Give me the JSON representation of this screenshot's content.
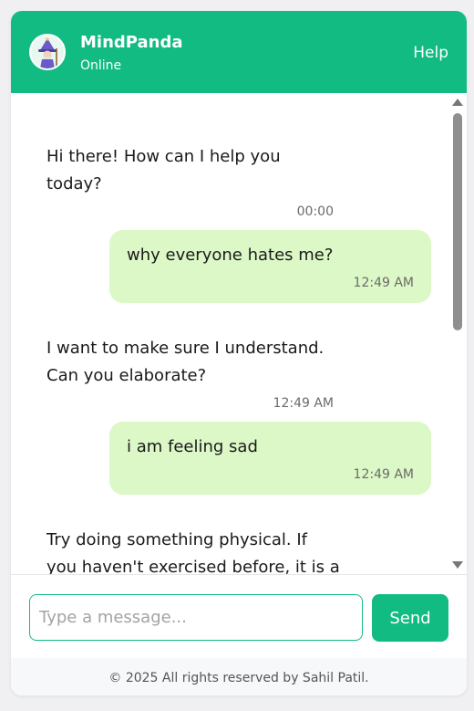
{
  "header": {
    "title": "MindPanda",
    "status": "Online",
    "help_label": "Help",
    "avatar_icon": "wizard-avatar-icon"
  },
  "messages": [
    {
      "sender": "bot",
      "lines": [
        "Hi there! How can I help you",
        "today?"
      ],
      "time": "00:00"
    },
    {
      "sender": "user",
      "text": "why everyone hates me?",
      "time": "12:49 AM"
    },
    {
      "sender": "bot",
      "lines": [
        "I want to make sure I understand.",
        "Can you elaborate?"
      ],
      "time": "12:49 AM"
    },
    {
      "sender": "user",
      "text": "i am feeling sad",
      "time": "12:49 AM"
    },
    {
      "sender": "bot",
      "lines": [
        "Try doing something physical. If",
        "you haven't exercised before, it is a"
      ]
    }
  ],
  "composer": {
    "placeholder": "Type a message...",
    "value": "",
    "send_label": "Send"
  },
  "footer": {
    "text": "© 2025 All rights reserved by Sahil Patil."
  },
  "colors": {
    "brand": "#12bb82",
    "user_bubble": "#dcf8c6",
    "background": "#f0f0f2"
  }
}
